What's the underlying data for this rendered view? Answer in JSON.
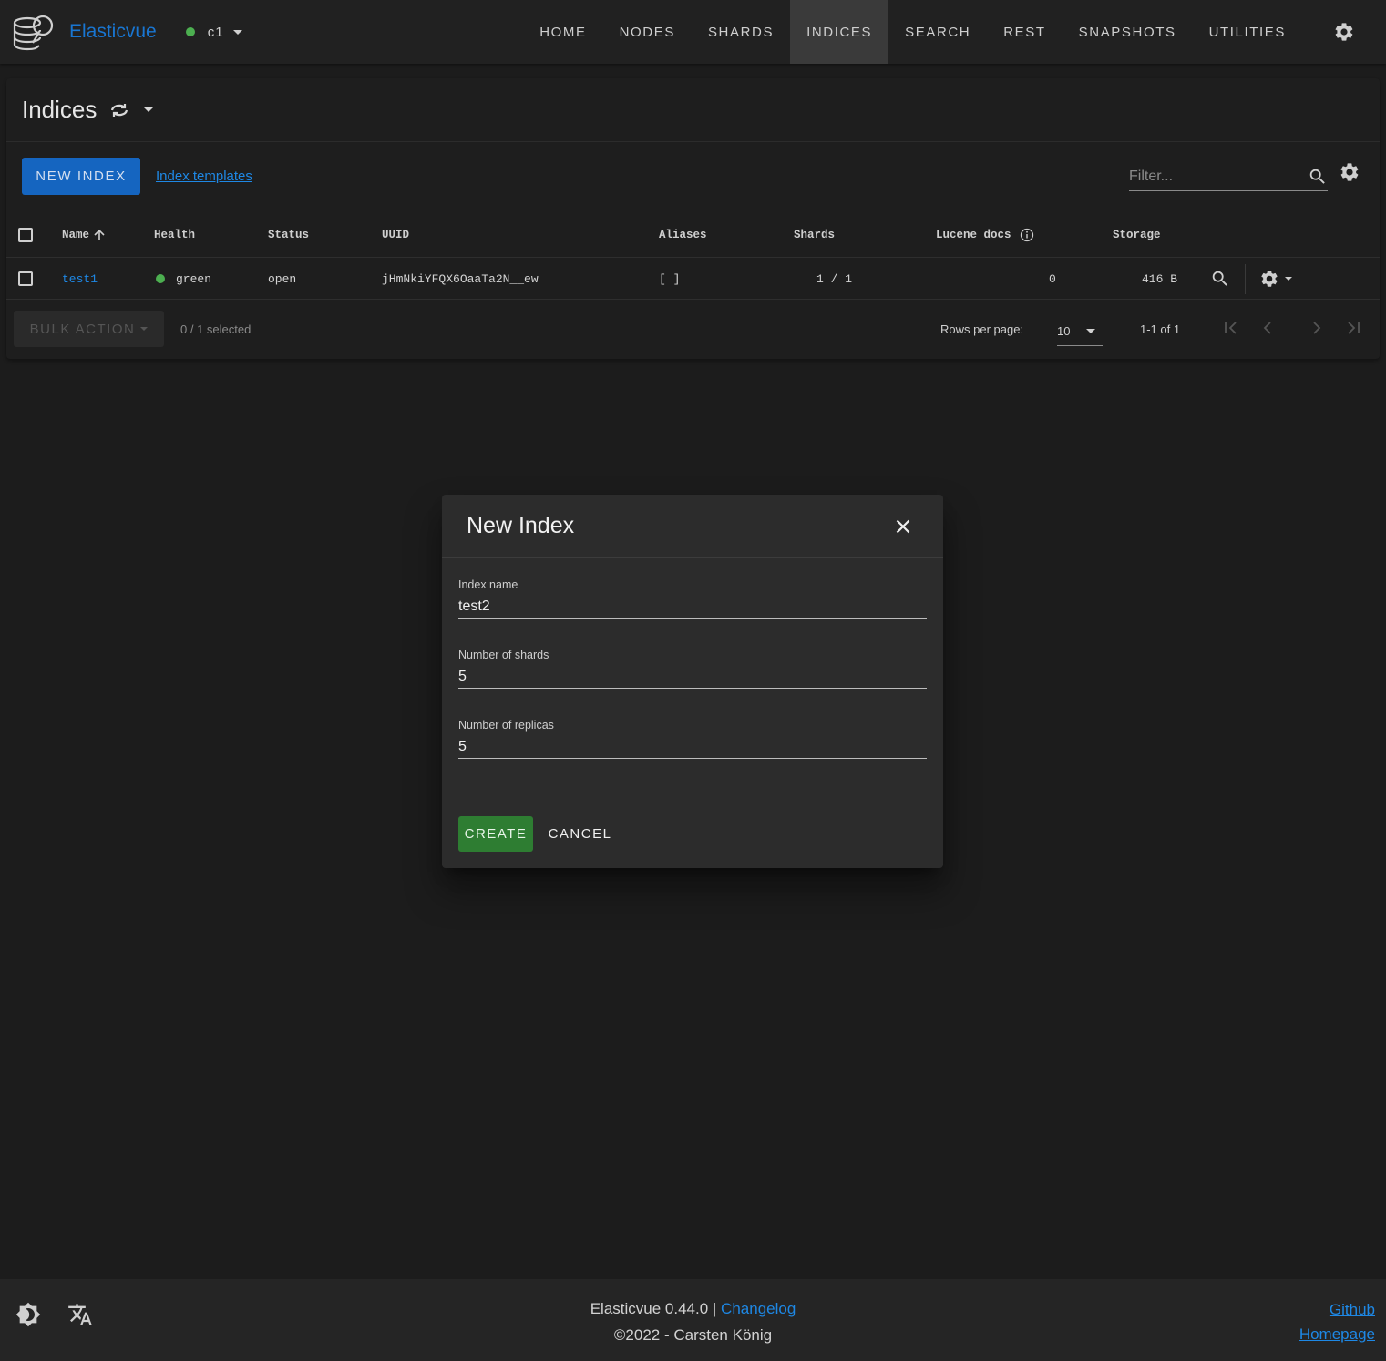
{
  "app": {
    "name": "Elasticvue",
    "cluster": {
      "name": "c1",
      "health_color": "#4caf50"
    }
  },
  "nav": {
    "items": [
      {
        "label": "HOME",
        "active": false
      },
      {
        "label": "NODES",
        "active": false
      },
      {
        "label": "SHARDS",
        "active": false
      },
      {
        "label": "INDICES",
        "active": true
      },
      {
        "label": "SEARCH",
        "active": false
      },
      {
        "label": "REST",
        "active": false
      },
      {
        "label": "SNAPSHOTS",
        "active": false
      },
      {
        "label": "UTILITIES",
        "active": false
      }
    ],
    "settings_icon": "gear-icon"
  },
  "indices_page": {
    "title": "Indices",
    "new_index_label": "NEW INDEX",
    "templates_link": "Index templates",
    "filter_placeholder": "Filter...",
    "columns": [
      "Name",
      "Health",
      "Status",
      "UUID",
      "Aliases",
      "Shards",
      "Lucene docs",
      "Storage"
    ],
    "sort_column": "Name",
    "rows": [
      {
        "name": "test1",
        "health": "green",
        "status": "open",
        "uuid": "jHmNkiYFQX6OaaTa2N__ew",
        "aliases": "[ ]",
        "shards": "1 / 1",
        "lucene_docs": "0",
        "storage": "416 B"
      }
    ],
    "bulk_action_label": "BULK ACTION",
    "selected_text": "0 / 1 selected",
    "rows_per_page_label": "Rows per page:",
    "rows_per_page_value": "10",
    "range_text": "1-1 of 1"
  },
  "dialog": {
    "title": "New Index",
    "fields": {
      "index_name": {
        "label": "Index name",
        "value": "test2"
      },
      "shards": {
        "label": "Number of shards",
        "value": "5"
      },
      "replicas": {
        "label": "Number of replicas",
        "value": "5"
      }
    },
    "create_label": "CREATE",
    "cancel_label": "CANCEL"
  },
  "footer": {
    "version_text": "Elasticvue 0.44.0 |",
    "changelog_link": "Changelog",
    "copyright": "©2022 - Carsten König",
    "github_link": "Github",
    "homepage_link": "Homepage"
  },
  "colors": {
    "accent": "#1976d2",
    "primary_button": "#1565c0",
    "create_button": "#2e7d32",
    "health_green": "#4caf50"
  }
}
